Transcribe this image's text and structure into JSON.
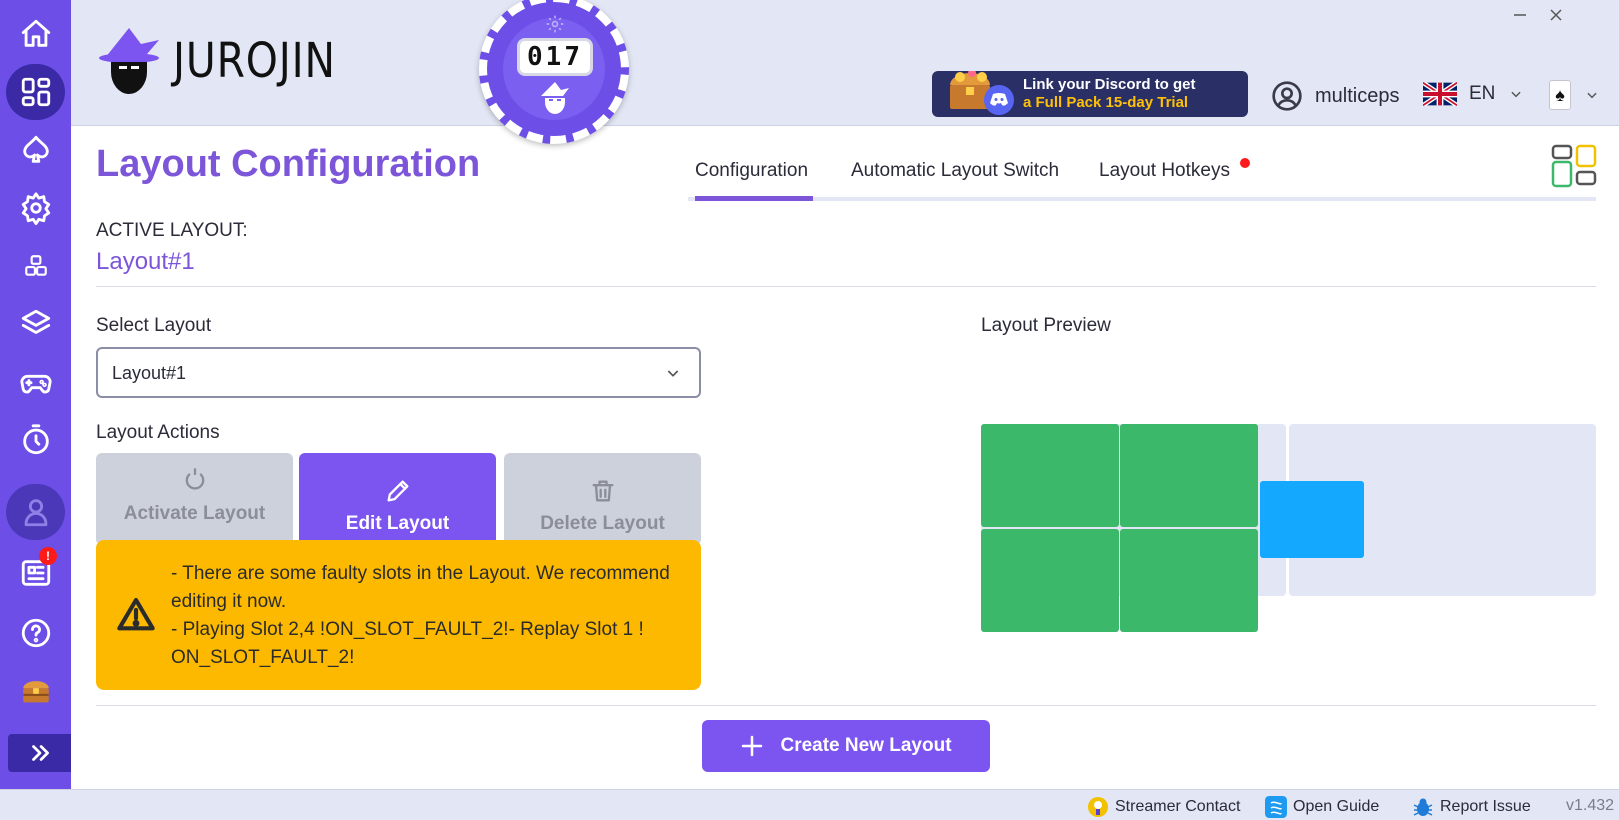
{
  "app": {
    "brand": "JUROJIN",
    "counter": "017"
  },
  "header": {
    "discord_line1": "Link your Discord to get",
    "discord_line2": "a Full Pack 15-day Trial",
    "username": "multiceps",
    "language": "EN"
  },
  "page": {
    "title": "Layout Configuration",
    "tabs": [
      {
        "label": "Configuration",
        "active": true
      },
      {
        "label": "Automatic Layout Switch",
        "active": false
      },
      {
        "label": "Layout Hotkeys",
        "active": false,
        "notification_dot": true
      }
    ],
    "active_layout_label": "ACTIVE LAYOUT:",
    "active_layout_value": "Layout#1",
    "select_layout_label": "Select Layout",
    "select_layout_value": "Layout#1",
    "layout_actions_label": "Layout Actions",
    "actions": {
      "activate": "Activate Layout",
      "edit": "Edit Layout",
      "delete": "Delete Layout"
    },
    "warning": {
      "line1": "- There are some faulty slots in the Layout. We recommend editing it now.",
      "line2": "- Playing Slot 2,4 !ON_SLOT_FAULT_2!- Replay Slot 1 ! ON_SLOT_FAULT_2!"
    },
    "preview_label": "Layout Preview",
    "create_button": "Create New Layout"
  },
  "sidebar": {
    "notification_badge": "!"
  },
  "footer": {
    "streamer_contact": "Streamer Contact",
    "open_guide": "Open Guide",
    "report_issue": "Report Issue",
    "version": "v1.432"
  },
  "colors": {
    "accent": "#7c55f0",
    "sidebar": "#6d4fe8",
    "warning": "#fdb900",
    "slot_green": "#3cb86a",
    "slot_blue": "#14a9ff"
  },
  "icons": {
    "sidebar": [
      "home-icon",
      "dashboard-icon",
      "spade-icon",
      "settings-icon",
      "hotkeys-icon",
      "layers-icon",
      "gamepad-icon",
      "timer-icon",
      "profile-icon",
      "news-icon",
      "help-icon",
      "chest-icon"
    ],
    "expand": "double-chevron-right-icon"
  }
}
